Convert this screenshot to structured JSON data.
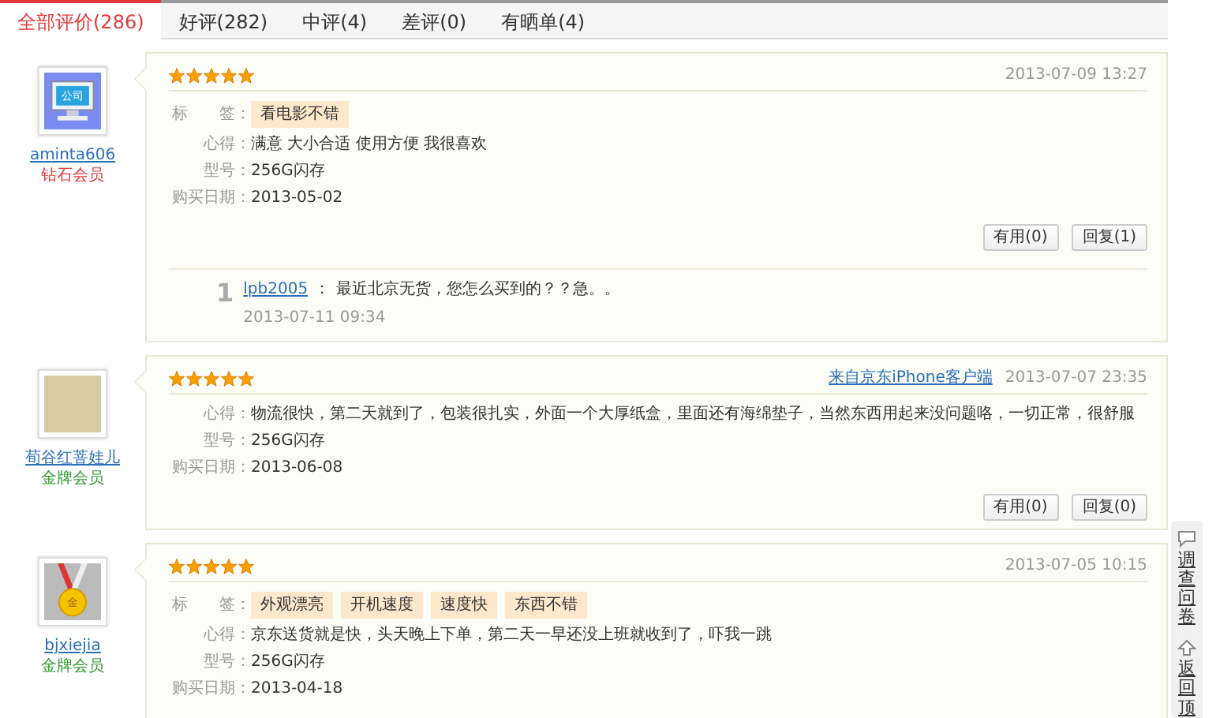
{
  "tabs": [
    {
      "label": "全部评价(286)",
      "selected": true
    },
    {
      "label": "好评(282)",
      "selected": false
    },
    {
      "label": "中评(4)",
      "selected": false
    },
    {
      "label": "差评(0)",
      "selected": false
    },
    {
      "label": "有晒单(4)",
      "selected": false
    }
  ],
  "reviews": [
    {
      "user": {
        "name": "aminta606",
        "level": "钻石会员",
        "color": "#e4393c",
        "avatar": {
          "kind": "monitor",
          "text": "公司"
        }
      },
      "stars": 5,
      "date": "2013-07-09 13:27",
      "fields": [
        {
          "kind": "tags",
          "label": "标　　签：",
          "tags": [
            "看电影不错"
          ]
        },
        {
          "kind": "text",
          "label": "心得：",
          "value": "满意 大小合适 使用方便 我很喜欢"
        },
        {
          "kind": "text",
          "label": "型号：",
          "value": "256G闪存"
        },
        {
          "kind": "text",
          "label": "购买日期：",
          "value": "2013-05-02"
        }
      ],
      "buttons": [
        "有用(0)",
        "回复(1)"
      ],
      "replies": [
        {
          "index": "1",
          "user": "lpb2005",
          "separator": "：",
          "text": "最近北京无货，您怎么买到的？？急。。",
          "date": "2013-07-11 09:34"
        }
      ]
    },
    {
      "user": {
        "name": "荀谷红菩娃儿",
        "level": "金牌会员",
        "color": "#339933",
        "avatar": {
          "kind": "photo"
        }
      },
      "stars": 5,
      "source": "来自京东iPhone客户端",
      "date": "2013-07-07 23:35",
      "fields": [
        {
          "kind": "text",
          "label": "心得：",
          "value": "物流很快，第二天就到了，包装很扎实，外面一个大厚纸盒，里面还有海绵垫子，当然东西用起来没问题咯，一切正常，很舒服"
        },
        {
          "kind": "text",
          "label": "型号：",
          "value": "256G闪存"
        },
        {
          "kind": "text",
          "label": "购买日期：",
          "value": "2013-06-08"
        }
      ],
      "buttons": [
        "有用(0)",
        "回复(0)"
      ]
    },
    {
      "user": {
        "name": "bjxiejia",
        "level": "金牌会员",
        "color": "#339933",
        "avatar": {
          "kind": "medal",
          "text": "金"
        }
      },
      "stars": 5,
      "date": "2013-07-05 10:15",
      "fields": [
        {
          "kind": "tags",
          "label": "标　　签：",
          "tags": [
            "外观漂亮",
            "开机速度",
            "速度快",
            "东西不错"
          ]
        },
        {
          "kind": "text",
          "label": "心得：",
          "value": "京东送货就是快，头天晚上下单，第二天一早还没上班就收到了，吓我一跳"
        },
        {
          "kind": "text",
          "label": "型号：",
          "value": "256G闪存"
        },
        {
          "kind": "text",
          "label": "购买日期：",
          "value": "2013-04-18"
        }
      ]
    }
  ],
  "side_tabs": [
    {
      "kind": "survey",
      "label": "调查问卷"
    },
    {
      "kind": "top",
      "label": "返回顶"
    }
  ]
}
